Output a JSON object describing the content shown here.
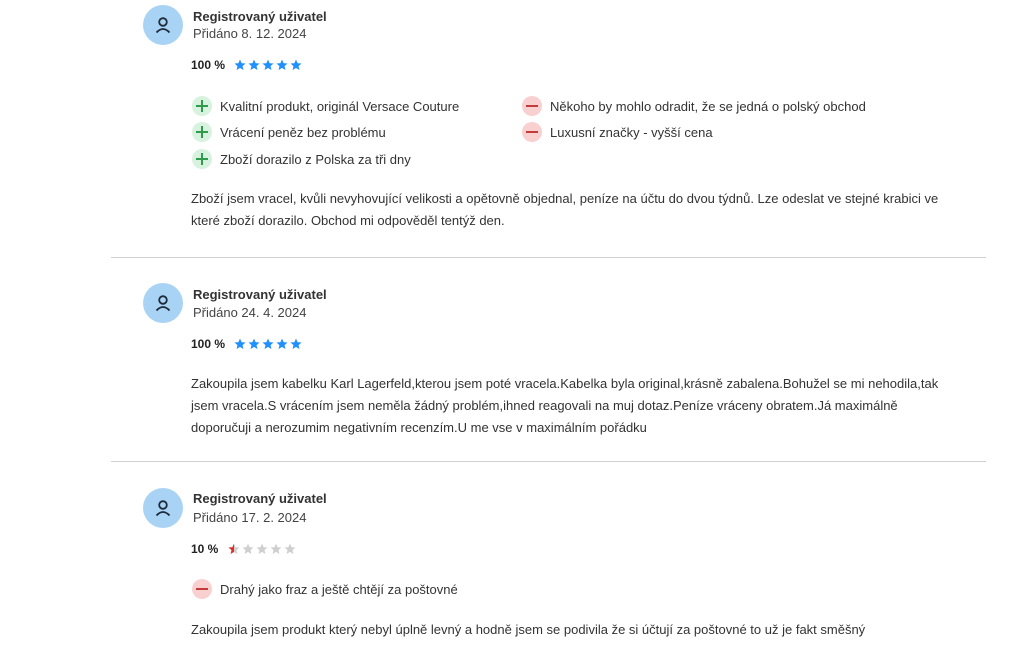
{
  "colors": {
    "star_filled": "#1e90ff",
    "star_empty": "#cfcfcf",
    "star_partial": "#e02b2b",
    "avatar_bg": "#a9d3f5"
  },
  "reviews": [
    {
      "author": "Registrovaný uživatel",
      "date": "Přidáno 8. 12. 2024",
      "rating_pct": "100 %",
      "rating": 1.0,
      "pros": [
        "Kvalitní produkt, originál Versace Couture",
        "Vrácení peněz bez problému",
        "Zboží dorazilo z Polska za tři dny"
      ],
      "cons": [
        "Někoho by mohlo odradit, že se jedná o polský obchod",
        "Luxusní značky - vyšší cena"
      ],
      "text": "Zboží jsem vracel, kvůli nevyhovující velikosti a opětovně objednal, peníze na účtu do dvou týdnů. Lze odeslat ve stejné krabici ve které zboží dorazilo. Obchod mi odpověděl tentýž den."
    },
    {
      "author": "Registrovaný uživatel",
      "date": "Přidáno 24. 4. 2024",
      "rating_pct": "100 %",
      "rating": 1.0,
      "pros": [],
      "cons": [],
      "text": "Zakoupila jsem kabelku Karl Lagerfeld,kterou jsem poté vracela.Kabelka byla original,krásně zabalena.Bohužel se mi nehodila,tak jsem vracela.S vrácením jsem neměla žádný problém,ihned reagovali na muj dotaz.Peníze vráceny obratem.Já maximálně doporučuji a nerozumim negativním recenzím.U me vse v maximálním pořádku"
    },
    {
      "author": "Registrovaný uživatel",
      "date": "Přidáno 17. 2. 2024",
      "rating_pct": "10 %",
      "rating": 0.1,
      "pros": [],
      "cons": [
        "Drahý jako fraz a ještě chtějí za poštovné"
      ],
      "text": "Zakoupila jsem produkt který nebyl úplně levný a hodně jsem se podivila že si účtují za poštovné to už je fakt směšný"
    }
  ]
}
